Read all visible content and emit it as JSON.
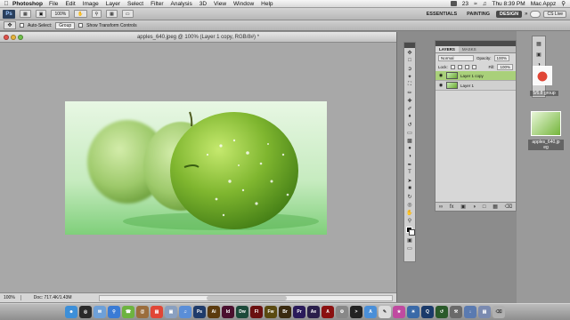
{
  "menubar": {
    "app_name": "Photoshop",
    "items": [
      "File",
      "Edit",
      "Image",
      "Layer",
      "Select",
      "Filter",
      "Analysis",
      "3D",
      "View",
      "Window",
      "Help"
    ],
    "battery": "23",
    "clock": "Thu 8:39 PM",
    "user": "Mac Appz"
  },
  "appbar": {
    "logo": "Ps",
    "zoom": "100%",
    "workspaces": [
      "ESSENTIALS",
      "PAINTING",
      "DESIGN"
    ],
    "active_workspace": "DESIGN",
    "cs_live": "CS Live"
  },
  "options": {
    "auto_select_label": "Auto-Select:",
    "auto_select_value": "Group",
    "show_transform_label": "Show Transform Controls"
  },
  "document": {
    "title": "apples_640.jpeg @ 100% (Layer 1 copy, RGB/8#) *",
    "zoom": "100%",
    "doc_size": "Doc: 717.4K/1.43M"
  },
  "layers_panel": {
    "tabs": [
      "LAYERS",
      "MASKS"
    ],
    "blend_mode": "Normal",
    "opacity_label": "Opacity:",
    "opacity_value": "100%",
    "lock_label": "Lock:",
    "fill_label": "Fill:",
    "fill_value": "100%",
    "layers": [
      {
        "name": "Layer 1 copy",
        "selected": true
      },
      {
        "name": "Layer 1",
        "selected": false
      }
    ]
  },
  "desktop": {
    "file_label_1": "apples_640.jp eg",
    "file_label_2": "5/6.8 group"
  },
  "colors": {
    "selected_layer": "#a9d07a",
    "apple_green": "#6fa52f"
  }
}
